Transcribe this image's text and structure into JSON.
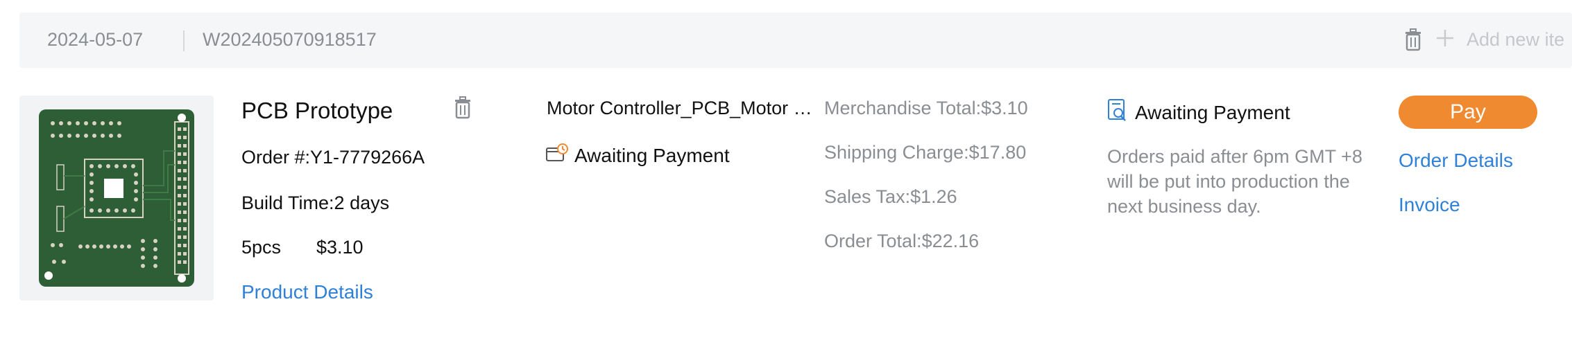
{
  "header": {
    "date": "2024-05-07",
    "order_number": "W202405070918517",
    "add_label": "Add new ite"
  },
  "product": {
    "title": "PCB Prototype",
    "order_no": "Order #:Y1-7779266A",
    "build_time": "Build Time:2 days",
    "quantity": "5pcs",
    "price": "$3.10",
    "details_link": "Product Details"
  },
  "file": {
    "name": "Motor Controller_PCB_Motor Controller",
    "status": "Awaiting Payment"
  },
  "costs": {
    "merchandise_total": "Merchandise Total:$3.10",
    "shipping_charge": "Shipping Charge:$17.80",
    "sales_tax": "Sales Tax:$1.26",
    "order_total": "Order Total:$22.16"
  },
  "payment": {
    "status": "Awaiting Payment",
    "notice": "Orders paid after 6pm GMT +8 will be put into production the next business day."
  },
  "actions": {
    "pay_label": "Pay",
    "order_details_label": "Order Details",
    "invoice_label": "Invoice"
  },
  "colors": {
    "accent_orange": "#ef8a30",
    "link_blue": "#2f80d8",
    "pcb_green": "#2e5e35",
    "muted_text": "#8a8d92"
  },
  "icons": {
    "header_delete": "trash-icon",
    "header_add": "plus-icon",
    "product_delete": "trash-icon",
    "file_status": "wallet-clock-icon",
    "payment_status": "document-search-icon"
  }
}
